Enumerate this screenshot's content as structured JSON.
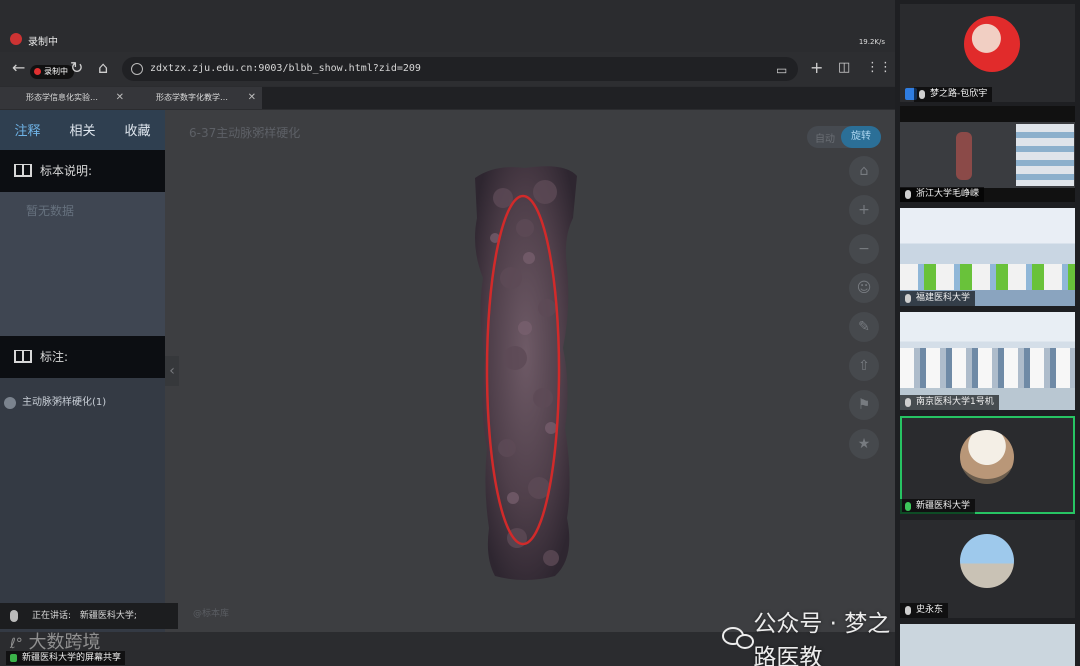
{
  "recording": {
    "label": "录制中",
    "pill": "录制中"
  },
  "status_bar": {
    "text": "19.2K/s"
  },
  "browser": {
    "url": "zdxtzx.zju.edu.cn:9003/blbb_show.html?zid=209",
    "tabs": [
      {
        "title": "形态学信息化实验…"
      },
      {
        "title": "形态学数字化教学…"
      }
    ]
  },
  "sidebar": {
    "tabs": [
      {
        "label": "注释"
      },
      {
        "label": "相关"
      },
      {
        "label": "收藏"
      }
    ],
    "specimen_desc_title": "标本说明:",
    "no_data": "暂无数据",
    "annotation_title": "标注:",
    "annotation_item": "主动脉粥样硬化(1)"
  },
  "viewer": {
    "title": "6-37主动脉粥样硬化",
    "toggle_off": "自动",
    "toggle_on": "旋转",
    "footnote": "@标本库",
    "tools": [
      "home-icon",
      "zoom-in-icon",
      "zoom-out-icon",
      "user-icon",
      "edit-icon",
      "upload-icon",
      "pin-icon",
      "star-icon"
    ]
  },
  "speaking": {
    "label": "正在讲话:",
    "name": "新疆医科大学;"
  },
  "watermark": {
    "text": "大数跨境"
  },
  "share_label": "新疆医科大学的屏幕共享",
  "wechat": {
    "text": "公众号 · 梦之路医教"
  },
  "participants": [
    {
      "name": "梦之路-包欣宇",
      "active": false
    },
    {
      "name": "浙江大学毛峥嵘",
      "active": false
    },
    {
      "name": "福建医科大学",
      "active": false
    },
    {
      "name": "南京医科大学1号机",
      "active": false
    },
    {
      "name": "新疆医科大学",
      "active": true
    },
    {
      "name": "史永东",
      "active": false
    }
  ],
  "colors": {
    "active_border": "#27c463",
    "toggle_on": "#2b6f97",
    "recording": "#e03030"
  }
}
